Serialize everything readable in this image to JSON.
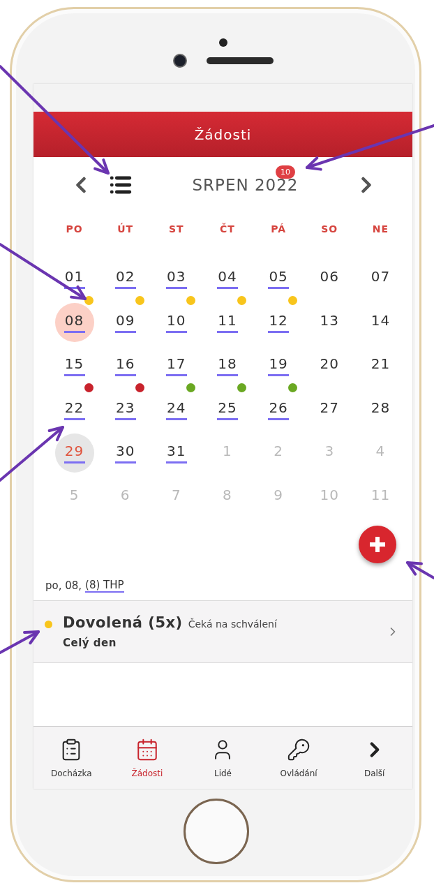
{
  "header": {
    "title": "Žádosti"
  },
  "calendar": {
    "month": "SRPEN 2022",
    "badge": "10",
    "weekdays": [
      "PO",
      "ÚT",
      "ST",
      "ČT",
      "PÁ",
      "SO",
      "NE"
    ],
    "weeks": [
      [
        {
          "label": "01",
          "kind": "current",
          "underlined": true,
          "selected": false,
          "today": false
        },
        {
          "label": "02",
          "kind": "current",
          "underlined": true,
          "selected": false,
          "today": false
        },
        {
          "label": "03",
          "kind": "current",
          "underlined": true,
          "selected": false,
          "today": false
        },
        {
          "label": "04",
          "kind": "current",
          "underlined": true,
          "selected": false,
          "today": false
        },
        {
          "label": "05",
          "kind": "current",
          "underlined": true,
          "selected": false,
          "today": false
        },
        {
          "label": "06",
          "kind": "current",
          "underlined": false,
          "selected": false,
          "today": false
        },
        {
          "label": "07",
          "kind": "current",
          "underlined": false,
          "selected": false,
          "today": false
        }
      ],
      [
        {
          "label": "08",
          "kind": "current",
          "underlined": true,
          "selected": true,
          "today": false,
          "color": "#f8c51c"
        },
        {
          "label": "09",
          "kind": "current",
          "underlined": true,
          "selected": false,
          "today": false,
          "color": "#f8c51c"
        },
        {
          "label": "10",
          "kind": "current",
          "underlined": true,
          "selected": false,
          "today": false,
          "color": "#f8c51c"
        },
        {
          "label": "11",
          "kind": "current",
          "underlined": true,
          "selected": false,
          "today": false,
          "color": "#f8c51c"
        },
        {
          "label": "12",
          "kind": "current",
          "underlined": true,
          "selected": false,
          "today": false,
          "color": "#f8c51c"
        },
        {
          "label": "13",
          "kind": "current",
          "underlined": false,
          "selected": false,
          "today": false
        },
        {
          "label": "14",
          "kind": "current",
          "underlined": false,
          "selected": false,
          "today": false
        }
      ],
      [
        {
          "label": "15",
          "kind": "current",
          "underlined": true,
          "selected": false,
          "today": false
        },
        {
          "label": "16",
          "kind": "current",
          "underlined": true,
          "selected": false,
          "today": false
        },
        {
          "label": "17",
          "kind": "current",
          "underlined": true,
          "selected": false,
          "today": false
        },
        {
          "label": "18",
          "kind": "current",
          "underlined": true,
          "selected": false,
          "today": false
        },
        {
          "label": "19",
          "kind": "current",
          "underlined": true,
          "selected": false,
          "today": false
        },
        {
          "label": "20",
          "kind": "current",
          "underlined": false,
          "selected": false,
          "today": false
        },
        {
          "label": "21",
          "kind": "current",
          "underlined": false,
          "selected": false,
          "today": false
        }
      ],
      [
        {
          "label": "22",
          "kind": "current",
          "underlined": true,
          "selected": false,
          "today": false,
          "color": "#c8232c"
        },
        {
          "label": "23",
          "kind": "current",
          "underlined": true,
          "selected": false,
          "today": false,
          "color": "#c8232c"
        },
        {
          "label": "24",
          "kind": "current",
          "underlined": true,
          "selected": false,
          "today": false,
          "color": "#6aa822"
        },
        {
          "label": "25",
          "kind": "current",
          "underlined": true,
          "selected": false,
          "today": false,
          "color": "#6aa822"
        },
        {
          "label": "26",
          "kind": "current",
          "underlined": true,
          "selected": false,
          "today": false,
          "color": "#6aa822"
        },
        {
          "label": "27",
          "kind": "current",
          "underlined": false,
          "selected": false,
          "today": false
        },
        {
          "label": "28",
          "kind": "current",
          "underlined": false,
          "selected": false,
          "today": false
        }
      ],
      [
        {
          "label": "29",
          "kind": "current",
          "underlined": true,
          "selected": false,
          "today": true
        },
        {
          "label": "30",
          "kind": "current",
          "underlined": true,
          "selected": false,
          "today": false
        },
        {
          "label": "31",
          "kind": "current",
          "underlined": true,
          "selected": false,
          "today": false
        },
        {
          "label": "1",
          "kind": "other",
          "underlined": false,
          "selected": false,
          "today": false
        },
        {
          "label": "2",
          "kind": "other",
          "underlined": false,
          "selected": false,
          "today": false
        },
        {
          "label": "3",
          "kind": "other",
          "underlined": false,
          "selected": false,
          "today": false
        },
        {
          "label": "4",
          "kind": "other",
          "underlined": false,
          "selected": false,
          "today": false
        }
      ],
      [
        {
          "label": "5",
          "kind": "other",
          "underlined": false,
          "selected": false,
          "today": false
        },
        {
          "label": "6",
          "kind": "other",
          "underlined": false,
          "selected": false,
          "today": false
        },
        {
          "label": "7",
          "kind": "other",
          "underlined": false,
          "selected": false,
          "today": false
        },
        {
          "label": "8",
          "kind": "other",
          "underlined": false,
          "selected": false,
          "today": false
        },
        {
          "label": "9",
          "kind": "other",
          "underlined": false,
          "selected": false,
          "today": false
        },
        {
          "label": "10",
          "kind": "other",
          "underlined": false,
          "selected": false,
          "today": false
        },
        {
          "label": "11",
          "kind": "other",
          "underlined": false,
          "selected": false,
          "today": false
        }
      ]
    ]
  },
  "selection": {
    "date": "po, 08,",
    "group": "(8) THP"
  },
  "requests": [
    {
      "title": "Dovolená (5x)",
      "status": "Čeká na schválení",
      "detail": "Celý den",
      "color": "#f8c51c"
    }
  ],
  "tabs": [
    {
      "label": "Docházka",
      "kind": "clipboard",
      "selected": false
    },
    {
      "label": "Žádosti",
      "kind": "calendar",
      "selected": true
    },
    {
      "label": "Lidé",
      "kind": "person",
      "selected": false
    },
    {
      "label": "Ovládání",
      "kind": "key",
      "selected": false
    },
    {
      "label": "Další",
      "kind": "more",
      "selected": false
    }
  ]
}
